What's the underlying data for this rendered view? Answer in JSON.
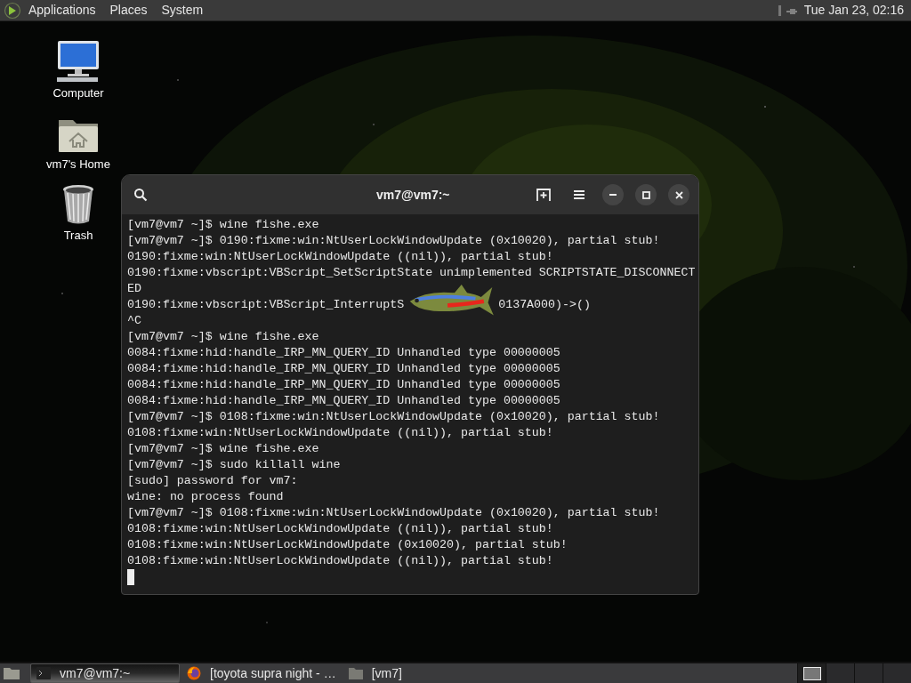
{
  "top_panel": {
    "menus": [
      "Applications",
      "Places",
      "System"
    ],
    "clock": "Tue Jan 23, 02:16"
  },
  "desktop_icons": [
    {
      "label": "Computer",
      "kind": "computer"
    },
    {
      "label": "vm7's Home",
      "kind": "home"
    },
    {
      "label": "Trash",
      "kind": "trash"
    }
  ],
  "terminal": {
    "title": "vm7@vm7:~",
    "lines": [
      {
        "text": "[vm7@vm7 ~]$ wine fishe.exe"
      },
      {
        "text": "[vm7@vm7 ~]$ 0190:fixme:win:NtUserLockWindowUpdate (0x10020), partial stub!"
      },
      {
        "text": "0190:fixme:win:NtUserLockWindowUpdate ((nil)), partial stub!"
      },
      {
        "text": "0190:fixme:vbscript:VBScript_SetScriptState unimplemented SCRIPTSTATE_DISCONNECT"
      },
      {
        "text": "ED"
      },
      {
        "text": "0190:fixme:vbscript:VBScript_InterruptS",
        "after": "0137A000)->()"
      },
      {
        "text": "^C"
      },
      {
        "text": "[vm7@vm7 ~]$ wine fishe.exe"
      },
      {
        "text": "0084:fixme:hid:handle_IRP_MN_QUERY_ID Unhandled type 00000005"
      },
      {
        "text": "0084:fixme:hid:handle_IRP_MN_QUERY_ID Unhandled type 00000005"
      },
      {
        "text": "0084:fixme:hid:handle_IRP_MN_QUERY_ID Unhandled type 00000005"
      },
      {
        "text": "0084:fixme:hid:handle_IRP_MN_QUERY_ID Unhandled type 00000005"
      },
      {
        "text": "[vm7@vm7 ~]$ 0108:fixme:win:NtUserLockWindowUpdate (0x10020), partial stub!"
      },
      {
        "text": "0108:fixme:win:NtUserLockWindowUpdate ((nil)), partial stub!"
      },
      {
        "text": "[vm7@vm7 ~]$ wine fishe.exe"
      },
      {
        "text": "[vm7@vm7 ~]$ sudo killall wine"
      },
      {
        "text": "[sudo] password for vm7:"
      },
      {
        "text": "wine: no process found"
      },
      {
        "text": "[vm7@vm7 ~]$ 0108:fixme:win:NtUserLockWindowUpdate (0x10020), partial stub!"
      },
      {
        "text": "0108:fixme:win:NtUserLockWindowUpdate ((nil)), partial stub!"
      },
      {
        "text": "0108:fixme:win:NtUserLockWindowUpdate (0x10020), partial stub!"
      },
      {
        "text": "0108:fixme:win:NtUserLockWindowUpdate ((nil)), partial stub!"
      }
    ]
  },
  "taskbar": {
    "tasks": [
      {
        "label": "vm7@vm7:~",
        "kind": "terminal",
        "selected": true
      },
      {
        "label": "[toyota supra night - …",
        "kind": "browser",
        "selected": false
      },
      {
        "label": "[vm7]",
        "kind": "folder",
        "selected": false
      }
    ],
    "workspaces": [
      {
        "selected": true
      },
      {
        "selected": false
      },
      {
        "selected": false
      },
      {
        "selected": false
      }
    ]
  }
}
